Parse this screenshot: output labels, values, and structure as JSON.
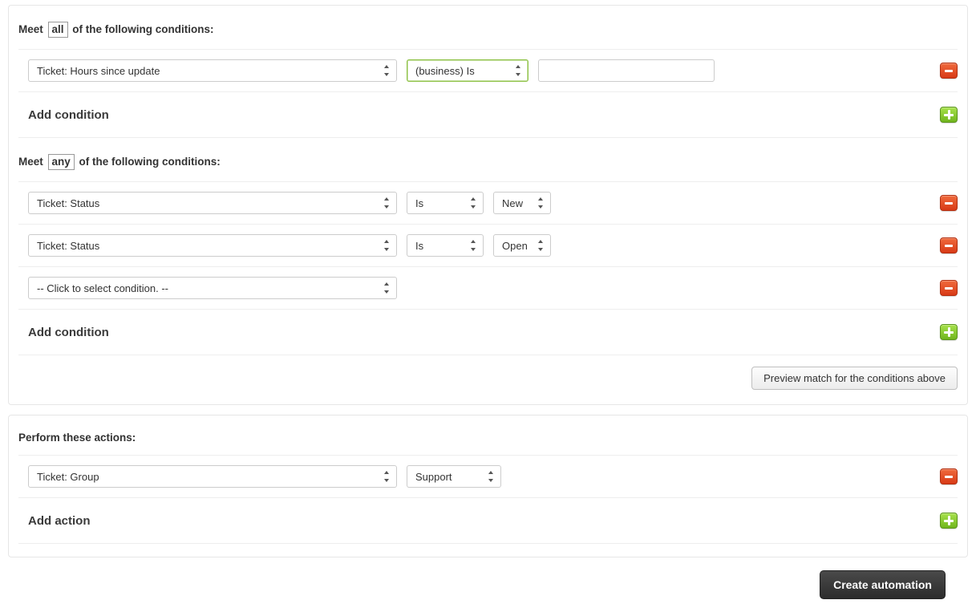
{
  "conditions_panel": {
    "all_group": {
      "header_pre": "Meet ",
      "header_badge": "all",
      "header_post": " of the following conditions:",
      "rows": [
        {
          "field": "Ticket: Hours since update",
          "operator": "(business) Is",
          "value": "",
          "operator_highlight": true,
          "has_text_value": true
        }
      ],
      "add_label": "Add condition"
    },
    "any_group": {
      "header_pre": "Meet ",
      "header_badge": "any",
      "header_post": " of the following conditions:",
      "rows": [
        {
          "field": "Ticket: Status",
          "operator": "Is",
          "value": "New"
        },
        {
          "field": "Ticket: Status",
          "operator": "Is",
          "value": "Open"
        },
        {
          "field": "-- Click to select condition. --"
        }
      ],
      "add_label": "Add condition"
    },
    "preview_label": "Preview match for the conditions above"
  },
  "actions_panel": {
    "header": "Perform these actions:",
    "rows": [
      {
        "field": "Ticket: Group",
        "value": "Support"
      }
    ],
    "add_label": "Add action"
  },
  "footer": {
    "create_label": "Create automation"
  }
}
